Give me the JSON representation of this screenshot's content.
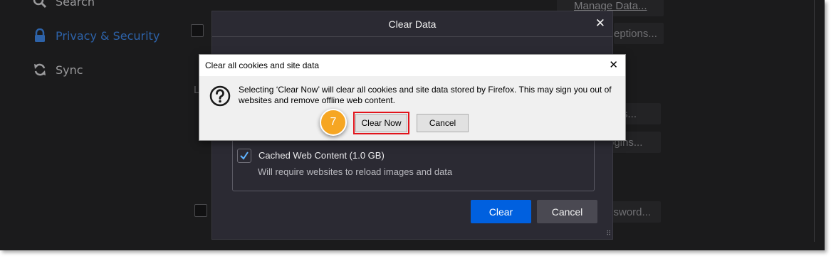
{
  "sidebar": {
    "items": [
      {
        "label": "Search",
        "icon": "search-icon"
      },
      {
        "label": "Privacy & Security",
        "icon": "lock-icon",
        "active": true
      },
      {
        "label": "Sync",
        "icon": "sync-icon"
      }
    ]
  },
  "background": {
    "manage_data_label": "Manage Data...",
    "exceptions_fragment": "eptions...",
    "fragment_s": "s...",
    "logins_fragment": "ogins...",
    "password_fragment": "ssword...",
    "letter_l": "L"
  },
  "clear_data_dialog": {
    "title": "Clear Data",
    "close_glyph": "✕",
    "cached_content_label": "Cached Web Content (1.0 GB)",
    "cached_content_checked": true,
    "cached_content_description": "Will require websites to reload images and data",
    "clear_button": "Clear",
    "cancel_button": "Cancel"
  },
  "confirm_dialog": {
    "title": "Clear all cookies and site data",
    "close_glyph": "✕",
    "message": "Selecting ‘Clear Now’ will clear all cookies and site data stored by Firefox. This may sign you out of websites and remove offline web content.",
    "clear_now_button": "Clear Now",
    "cancel_button": "Cancel"
  },
  "annotation": {
    "step_number": "7",
    "badge_color": "#f6a623",
    "highlight_color": "#e1141c"
  },
  "colors": {
    "accent_blue": "#0060df",
    "active_sidebar": "#2d62a8"
  }
}
